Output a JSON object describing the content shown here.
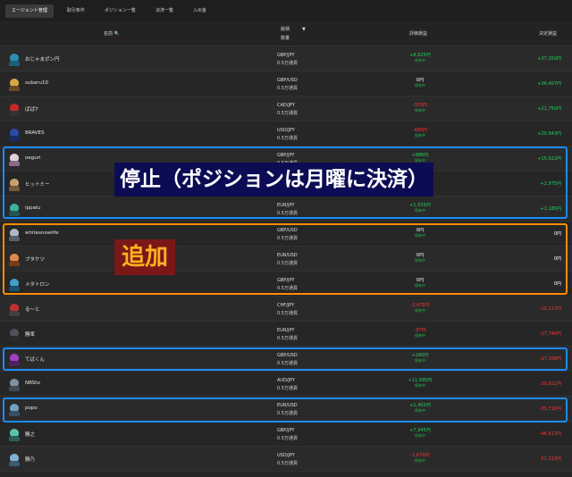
{
  "tabs": [
    "エージェント管理",
    "取引条件",
    "ポジション一覧",
    "決済一覧",
    "入出金"
  ],
  "header": {
    "name": "名前",
    "search_icon": "🔍",
    "symbol": "銘柄",
    "quantity": "数量",
    "sort_icon": "▼",
    "eval": "評価損益",
    "realized": "決定損益"
  },
  "rows": [
    {
      "name": "おじゃまポン円",
      "symbol": "GBP/JPY",
      "qty": "0.5万通貨",
      "eval": "+8,625円",
      "eval_status": "保有中",
      "eval_color": "pos",
      "pnl": "+37,250円",
      "pnl_color": "pos",
      "avatar": [
        "#2a8fb0",
        "#1b5f7a"
      ]
    },
    {
      "name": "subaru10",
      "symbol": "GBP/USD",
      "qty": "0.5万通貨",
      "eval": "0円",
      "eval_status": "保有中",
      "eval_color": "zero",
      "pnl": "+36,407円",
      "pnl_color": "pos",
      "avatar": [
        "#d8a64a",
        "#6b4a22"
      ]
    },
    {
      "name": "ぱぱ7",
      "symbol": "CAD/JPY",
      "qty": "0.5万通貨",
      "eval": "-333円",
      "eval_status": "保有中",
      "eval_color": "neg",
      "pnl": "+21,750円",
      "pnl_color": "pos",
      "avatar": [
        "#c62828",
        "#333333"
      ]
    },
    {
      "name": "BRAVES",
      "symbol": "USD/JPY",
      "qty": "0.5万通貨",
      "eval": "-480円",
      "eval_status": "保有中",
      "eval_color": "neg",
      "pnl": "+20,943円",
      "pnl_color": "pos",
      "avatar": [
        "#2c4aa8",
        "#1a2a66"
      ]
    },
    {
      "name": "oeguri",
      "symbol": "GBP/JPY",
      "qty": "0.5万通貨",
      "eval": "+886円",
      "eval_status": "保有中",
      "eval_color": "pos",
      "pnl": "+15,022円",
      "pnl_color": "pos",
      "avatar": [
        "#e0d0e0",
        "#8a6a8a"
      ]
    },
    {
      "name": "ヒットミー",
      "symbol": "GBP/USD",
      "qty": "0.5万通貨",
      "eval": "0円",
      "eval_status": "保有中",
      "eval_color": "zero",
      "pnl": "+2,975円",
      "pnl_color": "pos",
      "avatar": [
        "#c8a070",
        "#7a5a3a"
      ]
    },
    {
      "name": "ippatu",
      "symbol": "EUR/JPY",
      "qty": "0.5万通貨",
      "eval": "+1,555円",
      "eval_status": "保有中",
      "eval_color": "pos",
      "pnl": "+1,180円",
      "pnl_color": "pos",
      "avatar": [
        "#40b0a0",
        "#205850"
      ]
    },
    {
      "name": "whitesnowlife",
      "symbol": "GBP/USD",
      "qty": "0.5万通貨",
      "eval": "0円",
      "eval_status": "保有中",
      "eval_color": "zero",
      "pnl": "0円",
      "pnl_color": "zero",
      "avatar": [
        "#b0b8c8",
        "#5a6070"
      ]
    },
    {
      "name": "ブタケツ",
      "symbol": "EUR/USD",
      "qty": "0.5万通貨",
      "eval": "0円",
      "eval_status": "保有中",
      "eval_color": "zero",
      "pnl": "0円",
      "pnl_color": "zero",
      "avatar": [
        "#e08850",
        "#7a3a1a"
      ]
    },
    {
      "name": "メタトロン",
      "symbol": "GBP/JPY",
      "qty": "0.5万通貨",
      "eval": "0円",
      "eval_status": "保有中",
      "eval_color": "zero",
      "pnl": "0円",
      "pnl_color": "zero",
      "avatar": [
        "#40a0c8",
        "#1a5070"
      ]
    },
    {
      "name": "る～と",
      "symbol": "CHF/JPY",
      "qty": "0.5万通貨",
      "eval": "-2,470円",
      "eval_status": "保有中",
      "eval_color": "neg",
      "pnl": "-15,117円",
      "pnl_color": "neg",
      "avatar": [
        "#c03030",
        "#404040"
      ]
    },
    {
      "name": "勝率",
      "symbol": "EUR/JPY",
      "qty": "0.5万通貨",
      "eval": "-97円",
      "eval_status": "保有中",
      "eval_color": "neg",
      "pnl": "-17,746円",
      "pnl_color": "neg",
      "avatar": [
        "#505058",
        "#2a2a30"
      ]
    },
    {
      "name": "てばくん",
      "symbol": "GBP/USD",
      "qty": "0.5万通貨",
      "eval": "+240円",
      "eval_status": "保有中",
      "eval_color": "pos",
      "pnl": "-27,109円",
      "pnl_color": "neg",
      "avatar": [
        "#a040c0",
        "#502060"
      ]
    },
    {
      "name": "NBSto",
      "symbol": "AUD/JPY",
      "qty": "0.5万通貨",
      "eval": "+11,995円",
      "eval_status": "保有中",
      "eval_color": "pos",
      "pnl": "-30,921円",
      "pnl_color": "neg",
      "avatar": [
        "#8090a0",
        "#404a56"
      ]
    },
    {
      "name": "popo",
      "symbol": "EUR/USD",
      "qty": "0.5万通貨",
      "eval": "+1,402円",
      "eval_status": "保有中",
      "eval_color": "pos",
      "pnl": "-35,716円",
      "pnl_color": "neg",
      "avatar": [
        "#70a0c0",
        "#385066"
      ]
    },
    {
      "name": "勝之",
      "symbol": "GBP/JPY",
      "qty": "0.5万通貨",
      "eval": "+7,945円",
      "eval_status": "保有中",
      "eval_color": "pos",
      "pnl": "-46,611円",
      "pnl_color": "neg",
      "avatar": [
        "#60c0b0",
        "#2a6058"
      ]
    },
    {
      "name": "勝乃",
      "symbol": "USD/JPY",
      "qty": "0.5万通貨",
      "eval": "-1,670円",
      "eval_status": "保有中",
      "eval_color": "neg",
      "pnl": "-51,313円",
      "pnl_color": "neg",
      "avatar": [
        "#80b0d0",
        "#3a5a70"
      ]
    }
  ],
  "overlays": {
    "stop": "停止（ポジションは月曜に決済）",
    "add": "追加"
  }
}
